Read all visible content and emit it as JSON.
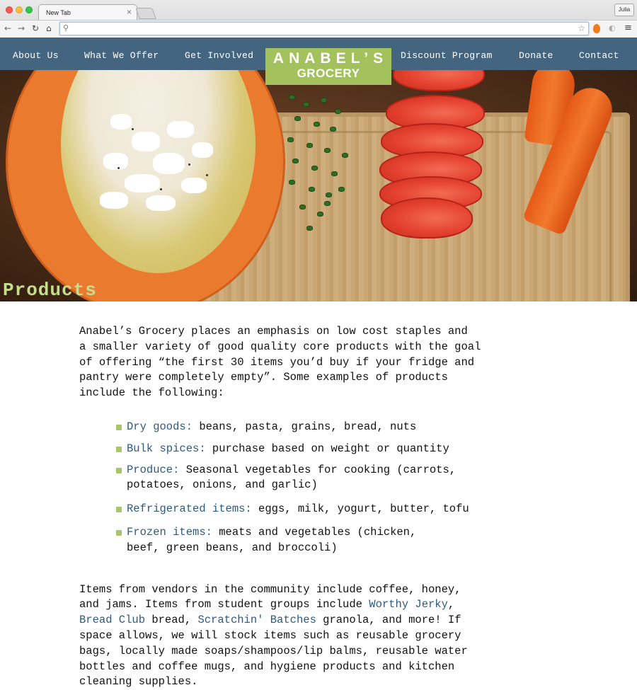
{
  "browser": {
    "tab_title": "New Tab",
    "tab_close": "×",
    "user": "Julia",
    "url": "",
    "icons": [
      "back-icon",
      "forward-icon",
      "reload-icon",
      "home-icon",
      "search-icon",
      "star-icon",
      "extension-icon",
      "menu-icon"
    ]
  },
  "nav": {
    "items": [
      "About Us",
      "What We Offer",
      "Get Involved",
      "Discount Program",
      "Donate",
      "Contact"
    ],
    "logo_top": "ANABEL’S",
    "logo_bottom": "GROCERY"
  },
  "hero": {
    "title": "Products"
  },
  "intro": "Anabel’s Grocery places an emphasis on low cost staples and\na smaller variety of good quality core products with the goal\nof offering “the first 30 items you’d buy if your fridge and\npantry were completely empty”. Some examples of products\ninclude the following:",
  "products": [
    {
      "term": "Dry goods:",
      "desc": " beans, pasta, grains, bread, nuts"
    },
    {
      "term": "Bulk spices:",
      "desc": " purchase based on weight or quantity"
    },
    {
      "term": "Produce:",
      "desc": " Seasonal vegetables for cooking (carrots,\npotatoes, onions, and garlic)"
    },
    {
      "term": "Refrigerated items:",
      "desc": " eggs, milk, yogurt, butter, tofu"
    },
    {
      "term": "Frozen items:",
      "desc": " meats and vegetables (chicken,\nbeef, green beans, and broccoli)"
    }
  ],
  "vendors": {
    "t1": "Items from vendors in the community include coffee, honey,\nand jams. Items from student groups include ",
    "link1": "Worthy Jerky",
    "t2": ",\n",
    "link2": "Bread Club",
    "t3": " bread, ",
    "link3": "Scratchin' Batches",
    "t4": " granola, and more! If\nspace allows, we will stock items such as reusable grocery\nbags, locally made soaps/shampoos/lip balms, reusable water\nbottles and coffee mugs, and hygiene products and kitchen\ncleaning supplies."
  },
  "colors": {
    "nav_bg": "#44657f",
    "logo_bg": "#a3c15d",
    "hero_title": "#c6dc8e",
    "link": "#2d5a80",
    "bullet": "#a9c46a"
  }
}
